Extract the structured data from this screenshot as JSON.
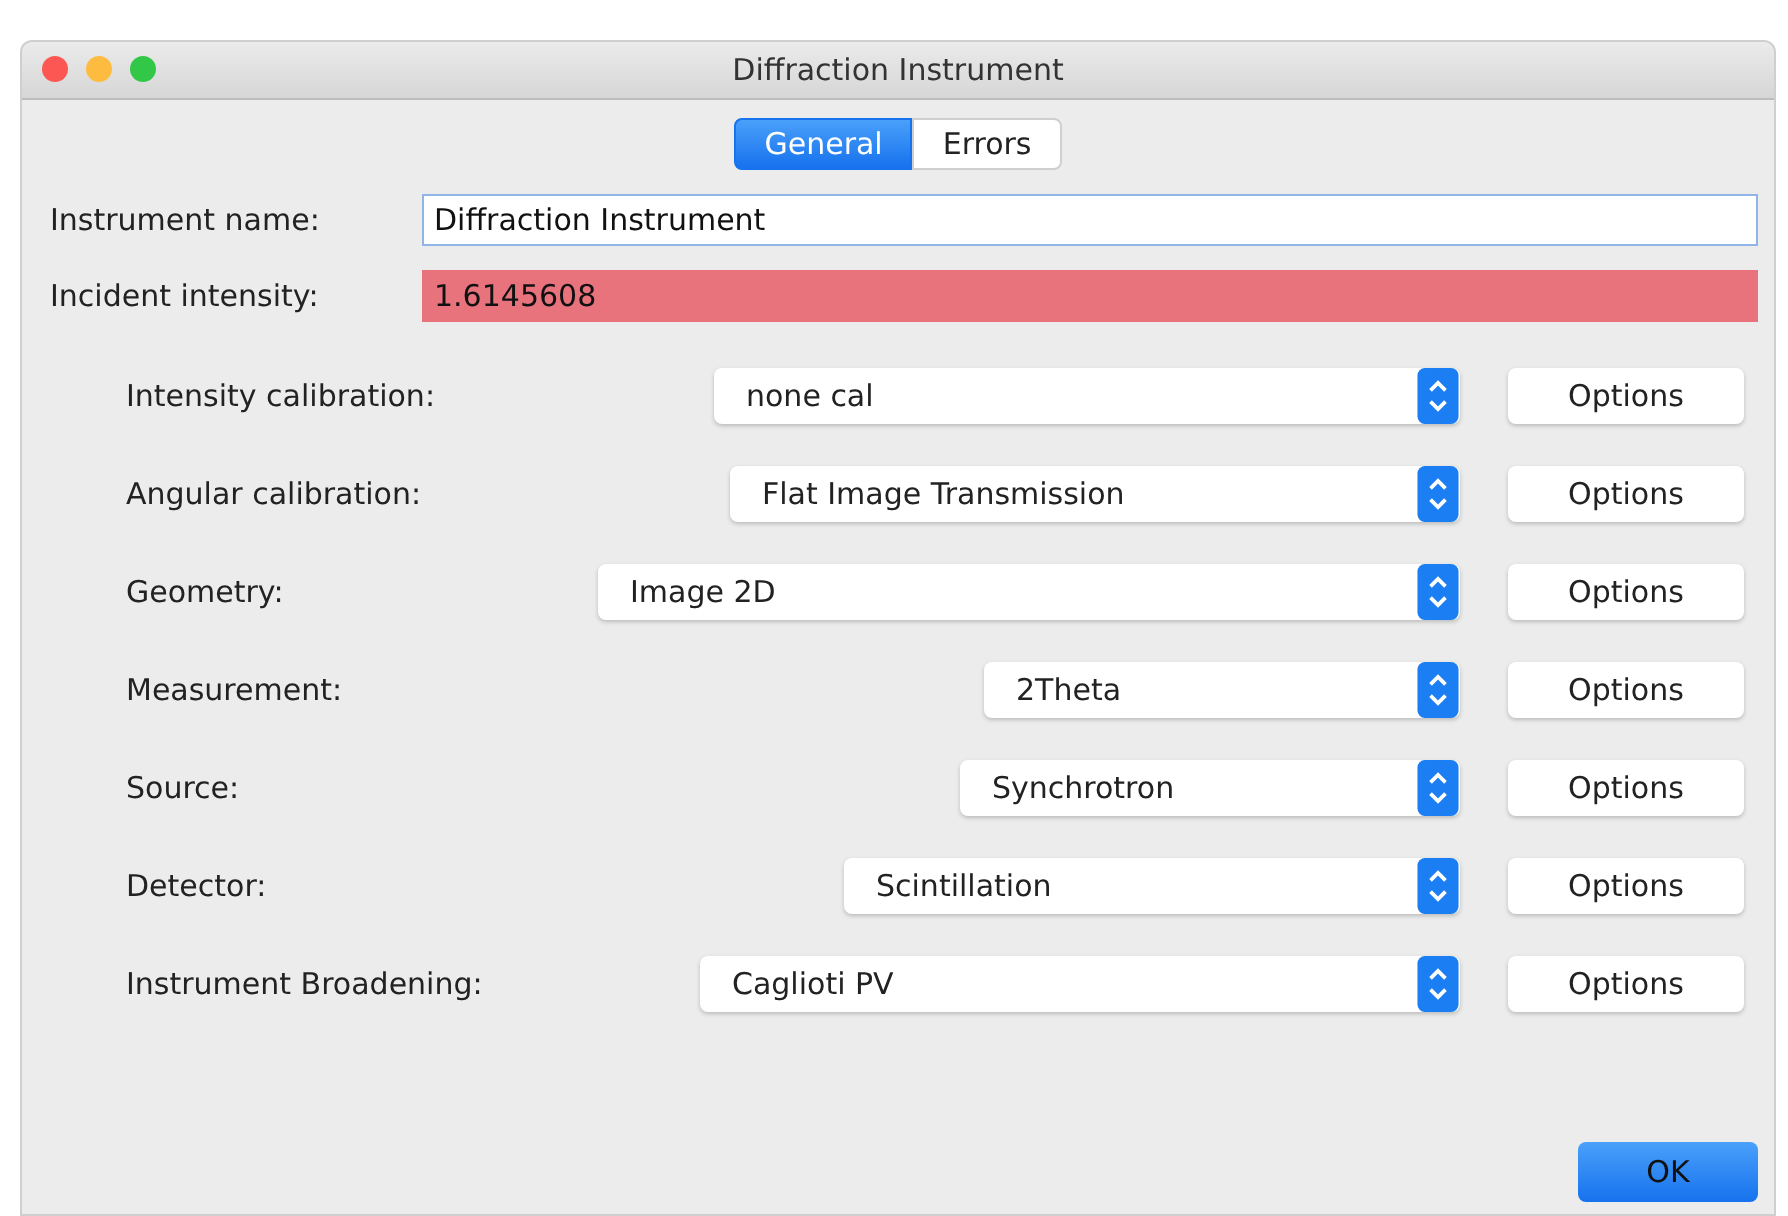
{
  "window": {
    "title": "Diffraction Instrument"
  },
  "tabs": [
    {
      "label": "General",
      "selected": true
    },
    {
      "label": "Errors",
      "selected": false
    }
  ],
  "fields": [
    {
      "label": "Instrument name:",
      "value": "Diffraction Instrument",
      "invalid": false
    },
    {
      "label": "Incident intensity:",
      "value": "1.6145608",
      "invalid": true
    }
  ],
  "settings": [
    {
      "label": "Intensity calibration:",
      "value": "none cal",
      "button": "Options"
    },
    {
      "label": "Angular calibration:",
      "value": "Flat Image Transmission",
      "button": "Options"
    },
    {
      "label": "Geometry:",
      "value": "Image 2D",
      "button": "Options"
    },
    {
      "label": "Measurement:",
      "value": "2Theta",
      "button": "Options"
    },
    {
      "label": "Source:",
      "value": "Synchrotron",
      "button": "Options"
    },
    {
      "label": "Detector:",
      "value": "Scintillation",
      "button": "Options"
    },
    {
      "label": "Instrument Broadening:",
      "value": "Caglioti PV",
      "button": "Options"
    }
  ],
  "buttons": [
    "OK"
  ]
}
